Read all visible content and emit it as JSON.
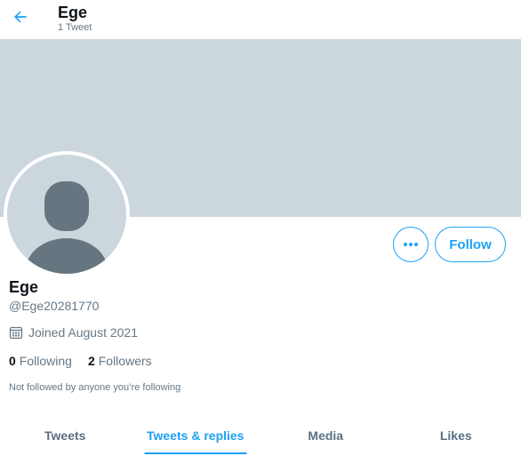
{
  "header": {
    "name": "Ege",
    "tweet_count": "1 Tweet"
  },
  "profile": {
    "display_name": "Ege",
    "handle": "@Ege20281770",
    "joined": "Joined August 2021",
    "following_count": "0",
    "following_label": "Following",
    "followers_count": "2",
    "followers_label": "Followers",
    "followed_note": "Not followed by anyone you’re following"
  },
  "actions": {
    "follow_label": "Follow",
    "more_icon": "more-horizontal-icon"
  },
  "tabs": [
    {
      "label": "Tweets",
      "active": false
    },
    {
      "label": "Tweets & replies",
      "active": true
    },
    {
      "label": "Media",
      "active": false
    },
    {
      "label": "Likes",
      "active": false
    }
  ],
  "colors": {
    "accent": "#1da1f2",
    "banner": "#ccd6dd",
    "avatar_silhouette": "#66757f",
    "secondary_text": "#657786"
  }
}
